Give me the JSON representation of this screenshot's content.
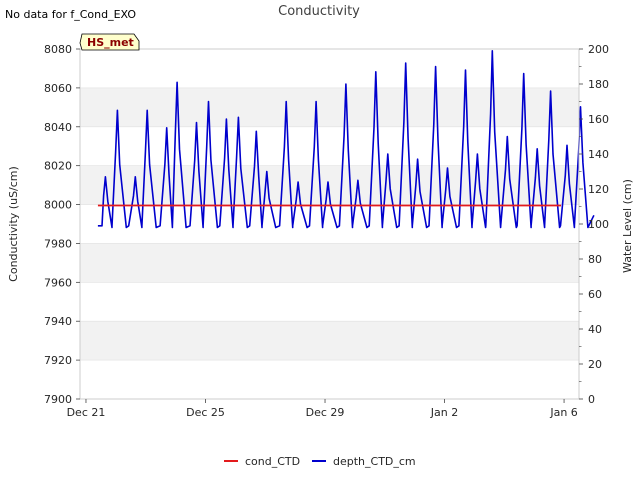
{
  "note": "No data for f_Cond_EXO",
  "badge": "HS_met",
  "colors": {
    "cond": "#e31a1c",
    "depth": "#0000cd",
    "band": "#f2f2f2",
    "badge_bg": "#ffffcc"
  },
  "chart_data": {
    "type": "line",
    "title": "Conductivity",
    "ylabel": "Conductivity (uS/cm)",
    "y2label": "Water Level (cm)",
    "ylim": [
      7900,
      8080
    ],
    "y2lim": [
      0,
      200
    ],
    "yticks": [
      7900,
      7920,
      7940,
      7960,
      7980,
      8000,
      8020,
      8040,
      8060,
      8080
    ],
    "y2ticks": [
      0,
      20,
      40,
      60,
      80,
      100,
      120,
      140,
      160,
      180,
      200
    ],
    "xlim": [
      -0.2,
      16.5
    ],
    "xticks": [
      {
        "value": 0,
        "label": "Dec 21"
      },
      {
        "value": 4,
        "label": "Dec 25"
      },
      {
        "value": 8,
        "label": "Dec 29"
      },
      {
        "value": 12,
        "label": "Jan 2"
      },
      {
        "value": 16,
        "label": "Jan 6"
      }
    ],
    "grid_bands": true,
    "legend_position": "bottom-center",
    "series": [
      {
        "name": "cond_CTD",
        "axis": "left",
        "color": "#e31a1c",
        "x": [
          0.4,
          17.0
        ],
        "values": [
          7999.5,
          7999.5
        ]
      },
      {
        "name": "depth_CTD_cm",
        "axis": "right",
        "color": "#0000cd",
        "peaks": [
          {
            "x": 0.65,
            "y": 127
          },
          {
            "x": 1.05,
            "y": 165
          },
          {
            "x": 1.65,
            "y": 127
          },
          {
            "x": 2.05,
            "y": 165
          },
          {
            "x": 2.7,
            "y": 155
          },
          {
            "x": 3.05,
            "y": 181
          },
          {
            "x": 3.7,
            "y": 158
          },
          {
            "x": 4.1,
            "y": 170
          },
          {
            "x": 4.7,
            "y": 160
          },
          {
            "x": 5.1,
            "y": 161
          },
          {
            "x": 5.7,
            "y": 153
          },
          {
            "x": 6.05,
            "y": 130
          },
          {
            "x": 6.7,
            "y": 170
          },
          {
            "x": 7.1,
            "y": 124
          },
          {
            "x": 7.7,
            "y": 170
          },
          {
            "x": 8.1,
            "y": 124
          },
          {
            "x": 8.7,
            "y": 180
          },
          {
            "x": 9.1,
            "y": 125
          },
          {
            "x": 9.7,
            "y": 187
          },
          {
            "x": 10.1,
            "y": 140
          },
          {
            "x": 10.7,
            "y": 192
          },
          {
            "x": 11.1,
            "y": 137
          },
          {
            "x": 11.7,
            "y": 190
          },
          {
            "x": 12.1,
            "y": 132
          },
          {
            "x": 12.7,
            "y": 188
          },
          {
            "x": 13.1,
            "y": 140
          },
          {
            "x": 13.6,
            "y": 199
          },
          {
            "x": 14.1,
            "y": 150
          },
          {
            "x": 14.65,
            "y": 186
          },
          {
            "x": 15.1,
            "y": 143
          },
          {
            "x": 15.55,
            "y": 176
          },
          {
            "x": 16.1,
            "y": 145
          },
          {
            "x": 16.55,
            "y": 167
          }
        ],
        "start": {
          "x": 0.4,
          "y": 99
        },
        "end": {
          "x": 17.0,
          "y": 105
        },
        "trough": 96
      }
    ]
  }
}
